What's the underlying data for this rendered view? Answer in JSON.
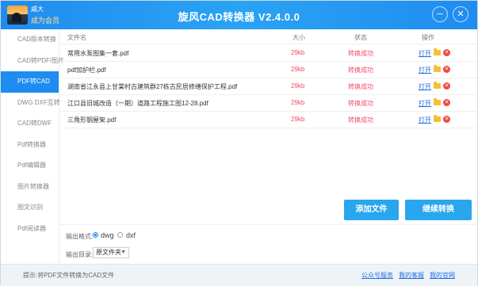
{
  "user": {
    "name": "威大",
    "membership": "成为会员"
  },
  "app": {
    "title": "旋风CAD转换器 V2.4.0.0"
  },
  "window_controls": {
    "minimize": "─",
    "close": "✕"
  },
  "sidebar": {
    "items": [
      {
        "label": "CAD版本转换",
        "active": false
      },
      {
        "label": "CAD转PDF/图片",
        "active": false
      },
      {
        "label": "PDF转CAD",
        "active": true
      },
      {
        "label": "DWG DXF互转",
        "active": false
      },
      {
        "label": "CAD转DWF",
        "active": false
      },
      {
        "label": "Pdf转换器",
        "active": false
      },
      {
        "label": "Pdf编辑器",
        "active": false
      },
      {
        "label": "图片转换器",
        "active": false
      },
      {
        "label": "图文识别",
        "active": false
      },
      {
        "label": "Pdf阅读器",
        "active": false
      }
    ]
  },
  "table": {
    "headers": {
      "name": "文件名",
      "size": "大小",
      "status": "状态",
      "action": "操作"
    },
    "rows": [
      {
        "name": "常用水泵图集一套.pdf",
        "size": "29kb",
        "status": "转换成功",
        "open": "打开"
      },
      {
        "name": "pdf加护栏.pdf",
        "size": "29kb",
        "status": "转换成功",
        "open": "打开"
      },
      {
        "name": "湖南省江永县上甘棠村古建筑群27栋古民居修缮保护工程.pdf",
        "size": "29kb",
        "status": "转换成功",
        "open": "打开"
      },
      {
        "name": "江口县旧城改造（一期）道路工程施工图12-28.pdf",
        "size": "29kb",
        "status": "转换成功",
        "open": "打开"
      },
      {
        "name": "三角形钢屋架.pdf",
        "size": "29kb",
        "status": "转换成功",
        "open": "打开"
      }
    ]
  },
  "buttons": {
    "add_file": "添加文件",
    "continue_convert": "继续转换"
  },
  "output": {
    "format_label": "输出格式:",
    "format_options": [
      "dwg",
      "dxf"
    ],
    "selected_format": "dwg",
    "dir_label": "输出目录:",
    "dir_value": "原文件夹"
  },
  "statusbar": {
    "hint": "提示:将PDF文件转换为CAD文件",
    "links": [
      "公众号服务",
      "我的客服",
      "我的官网"
    ]
  },
  "colors": {
    "accent": "#1f8cf0",
    "status_red": "#ee4d6b",
    "button": "#2aa6ee"
  }
}
